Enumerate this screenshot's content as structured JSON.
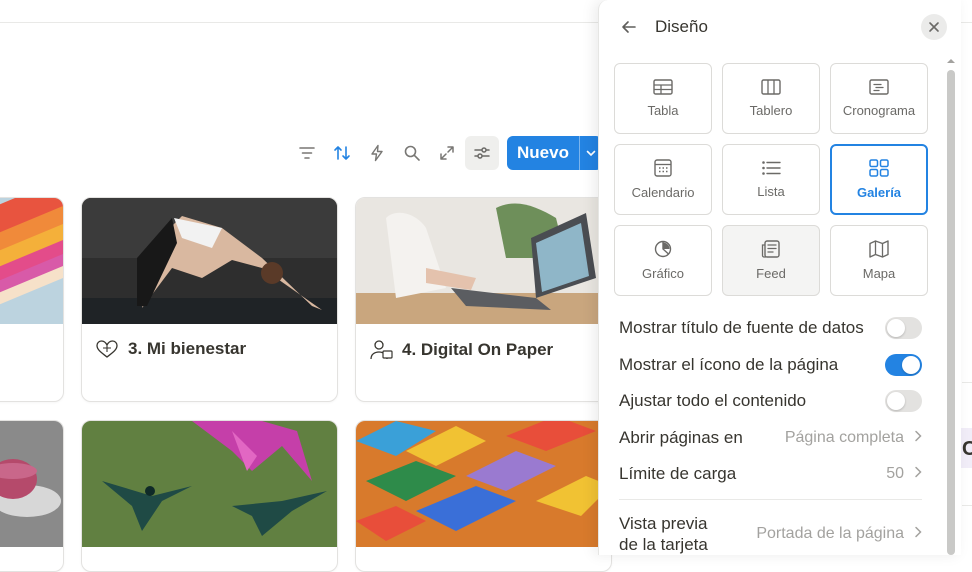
{
  "toolbar": {
    "icons": [
      "filter-icon",
      "sort-icon",
      "lightning-icon",
      "search-icon",
      "expand-icon",
      "settings-sliders-icon"
    ],
    "new_label": "Nuevo"
  },
  "cards": [
    {
      "title": ""
    },
    {
      "title": "3. Mi bienestar",
      "icon": "wellbeing-icon"
    },
    {
      "title": "4. Digital On Paper",
      "icon": "digital-person-icon"
    },
    {
      "title": ""
    },
    {
      "title": ""
    },
    {
      "title": ""
    }
  ],
  "panel": {
    "title": "Diseño",
    "layouts": [
      {
        "label": "Tabla",
        "icon": "table-icon"
      },
      {
        "label": "Tablero",
        "icon": "board-icon"
      },
      {
        "label": "Cronograma",
        "icon": "timeline-icon"
      },
      {
        "label": "Calendario",
        "icon": "calendar-icon"
      },
      {
        "label": "Lista",
        "icon": "list-icon"
      },
      {
        "label": "Galería",
        "icon": "gallery-icon",
        "selected": true
      },
      {
        "label": "Gráfico",
        "icon": "chart-icon"
      },
      {
        "label": "Feed",
        "icon": "feed-icon"
      },
      {
        "label": "Mapa",
        "icon": "map-icon"
      }
    ],
    "settings": {
      "show_source_title": {
        "label": "Mostrar título de fuente de datos",
        "on": false
      },
      "show_page_icon": {
        "label": "Mostrar el ícono de la página",
        "on": true
      },
      "wrap_content": {
        "label": "Ajustar todo el contenido",
        "on": false
      },
      "open_pages": {
        "label": "Abrir páginas en",
        "value": "Página completa"
      },
      "load_limit": {
        "label": "Límite de carga",
        "value": "50"
      },
      "card_preview": {
        "label_line1": "Vista previa",
        "label_line2": "de la tarjeta",
        "value": "Portada de la página"
      }
    }
  },
  "colors": {
    "accent": "#2383e2",
    "text": "#37352f",
    "muted": "#a3a29f"
  },
  "sliver": {
    "letter": "C"
  }
}
